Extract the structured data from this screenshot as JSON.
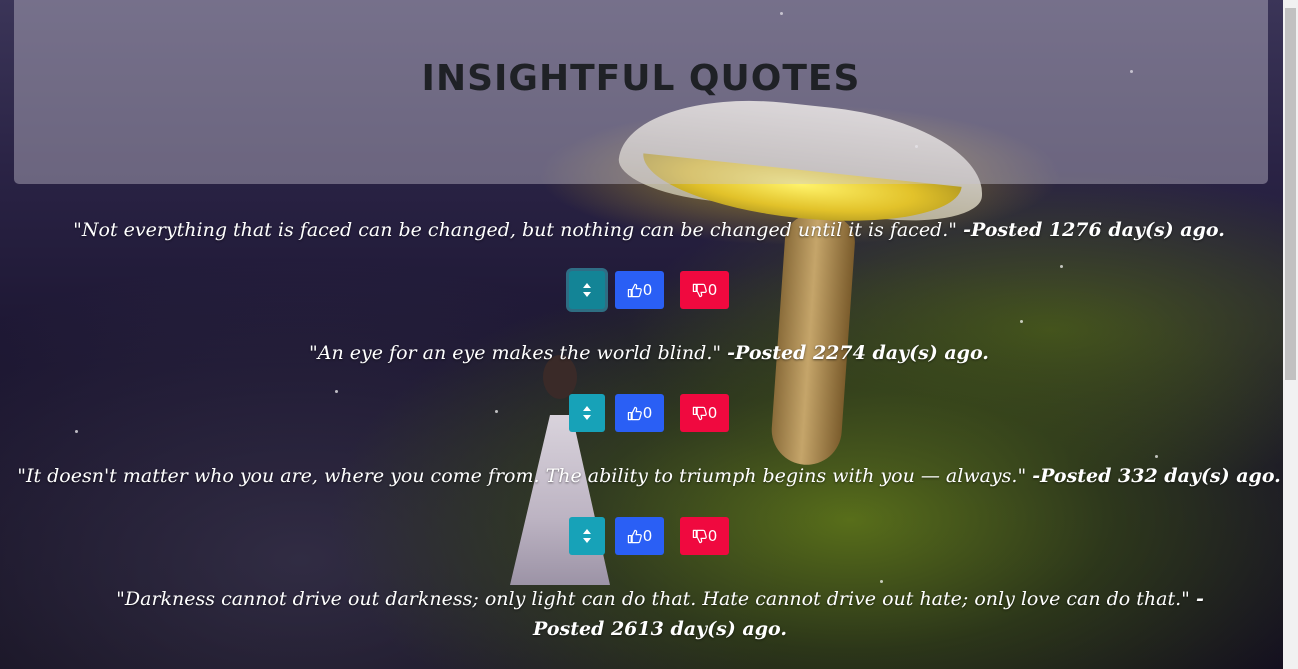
{
  "header": {
    "title": "INSIGHTFUL QUOTES"
  },
  "quotes": [
    {
      "text": "\"Not everything that is faced can be changed, but nothing can be changed until it is faced.\"",
      "posted": "-Posted 1276 day(s) ago.",
      "likes": "0",
      "dislikes": "0"
    },
    {
      "text": "\"An eye for an eye makes the world blind.\"",
      "posted": "-Posted 2274 day(s) ago.",
      "likes": "0",
      "dislikes": "0"
    },
    {
      "text": "\"It doesn't matter who you are, where you come from. The ability to triumph begins with you — always.\"",
      "posted": "-Posted 332 day(s) ago.",
      "likes": "0",
      "dislikes": "0"
    },
    {
      "text": "\"Darkness cannot drive out darkness; only light can do that. Hate cannot drive out hate; only love can do that.\"",
      "posted": "-Posted 2613 day(s) ago."
    }
  ],
  "icons": {
    "sort": "sort-icon",
    "like": "thumbs-up-icon",
    "dislike": "thumbs-down-icon"
  },
  "colors": {
    "sort_button": "#17a2b8",
    "like_button": "#2a5ff5",
    "dislike_button": "#f0093f"
  }
}
